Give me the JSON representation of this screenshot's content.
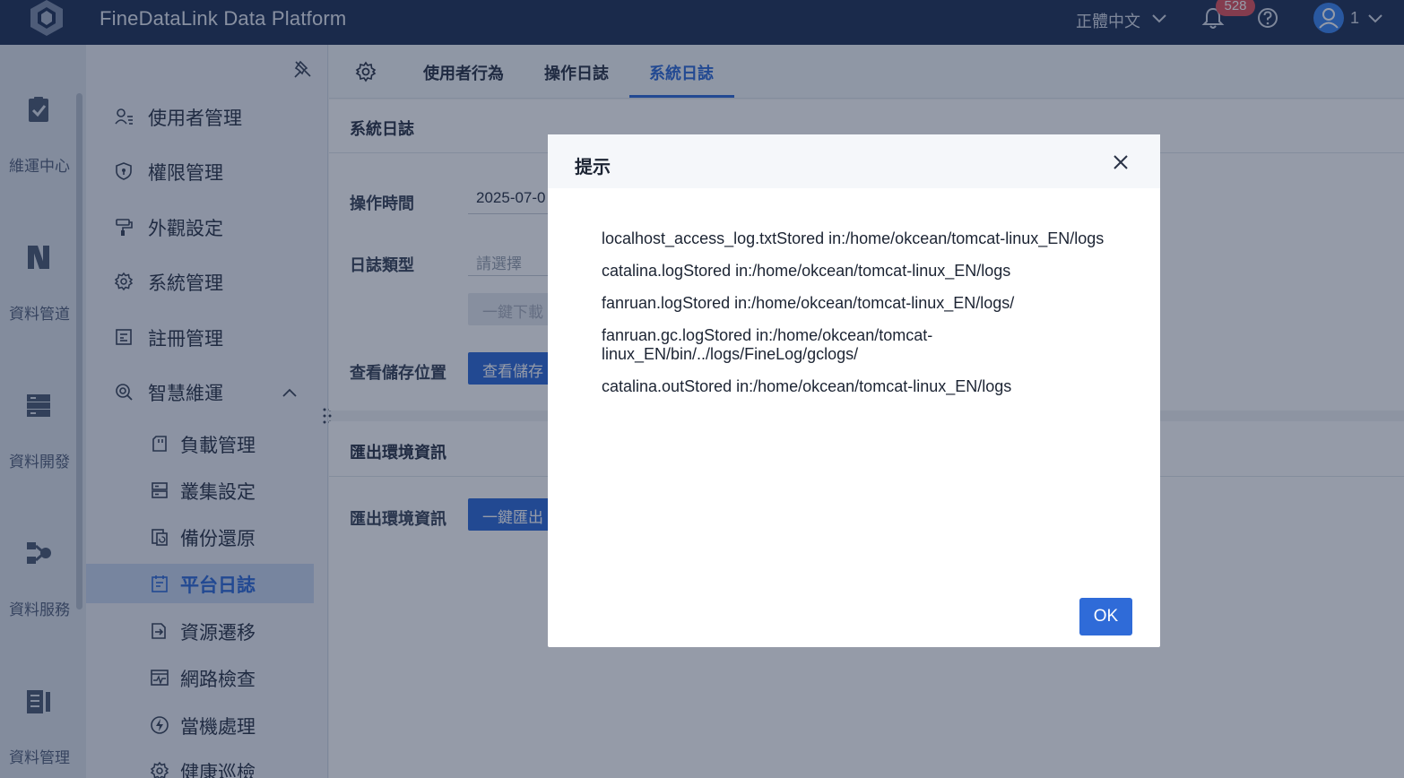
{
  "header": {
    "app_title": "FineDataLink Data Platform",
    "language": "正體中文",
    "notification_count": "528",
    "user_name": "1"
  },
  "rail": {
    "items": [
      {
        "label": "維運中心",
        "icon": "clipboard-check-icon"
      },
      {
        "label": "資料管道",
        "icon": "pipeline-icon"
      },
      {
        "label": "資料開發",
        "icon": "server-stack-icon"
      },
      {
        "label": "資料服務",
        "icon": "api-service-icon"
      },
      {
        "label": "資料管理",
        "icon": "data-catalog-icon"
      }
    ]
  },
  "menu": {
    "items": [
      {
        "label": "使用者管理",
        "icon": "user-list-icon"
      },
      {
        "label": "權限管理",
        "icon": "shield-icon"
      },
      {
        "label": "外觀設定",
        "icon": "paint-roller-icon"
      },
      {
        "label": "系統管理",
        "icon": "gear-icon"
      },
      {
        "label": "註冊管理",
        "icon": "register-icon"
      },
      {
        "label": "智慧維運",
        "icon": "smart-ops-icon"
      }
    ],
    "sub_items": [
      {
        "label": "負載管理",
        "icon": "sd-card-icon"
      },
      {
        "label": "叢集設定",
        "icon": "cluster-icon"
      },
      {
        "label": "備份還原",
        "icon": "backup-icon"
      },
      {
        "label": "平台日誌",
        "icon": "calendar-log-icon",
        "active": true
      },
      {
        "label": "資源遷移",
        "icon": "migrate-icon"
      },
      {
        "label": "網路檢查",
        "icon": "network-check-icon"
      },
      {
        "label": "當機處理",
        "icon": "lightning-icon"
      },
      {
        "label": "健康巡檢",
        "icon": "health-check-icon"
      }
    ]
  },
  "tabs": [
    {
      "label": "使用者行為"
    },
    {
      "label": "操作日誌"
    },
    {
      "label": "系統日誌",
      "active": true
    }
  ],
  "system_log": {
    "section_title": "系統日誌",
    "op_time_label": "操作時間",
    "op_time_value": "2025-07-0",
    "log_type_label": "日誌類型",
    "log_type_placeholder": "請選擇",
    "download_button": "一鍵下載",
    "storage_label": "查看儲存位置",
    "storage_button": "查看儲存"
  },
  "export_env": {
    "section_title": "匯出環境資訊",
    "label": "匯出環境資訊",
    "button": "一鍵匯出"
  },
  "dialog": {
    "title": "提示",
    "lines": [
      "localhost_access_log.txtStored in:/home/okcean/tomcat-linux_EN/logs",
      "catalina.logStored in:/home/okcean/tomcat-linux_EN/logs",
      "fanruan.logStored in:/home/okcean/tomcat-linux_EN/logs/",
      "fanruan.gc.logStored in:/home/okcean/tomcat-linux_EN/bin/../logs/FineLog/gclogs/",
      "catalina.outStored in:/home/okcean/tomcat-linux_EN/logs"
    ],
    "ok_label": "OK"
  },
  "colors": {
    "header_bg": "#1f3257",
    "accent": "#2f6bd8",
    "badge": "#e0525b"
  }
}
